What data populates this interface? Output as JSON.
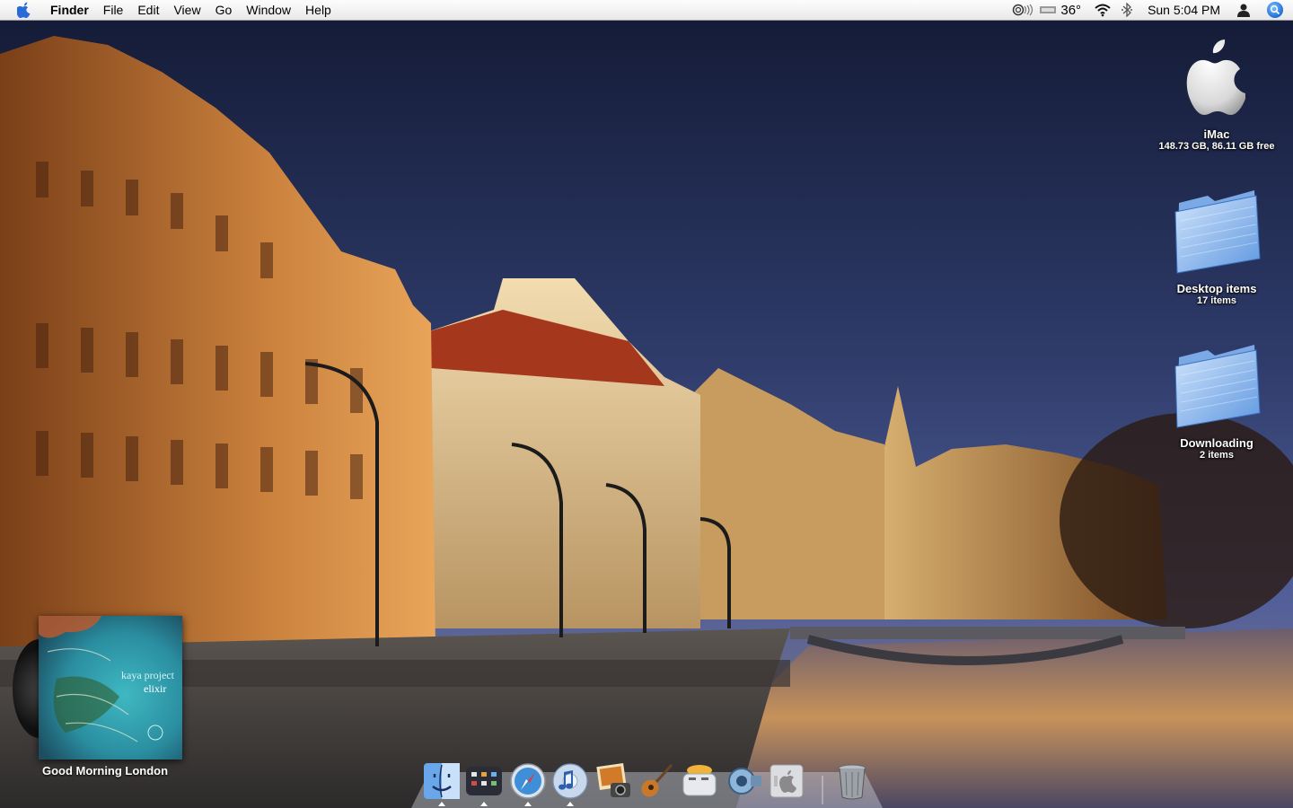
{
  "menubar": {
    "app_name": "Finder",
    "menus": [
      "File",
      "Edit",
      "View",
      "Go",
      "Window",
      "Help"
    ],
    "temperature": "36°",
    "clock": "Sun 5:04 PM",
    "icons": [
      "apple-icon",
      "airtunes-icon",
      "weather-icon",
      "wifi-icon",
      "bluetooth-icon",
      "user-icon",
      "spotlight-icon"
    ]
  },
  "desktop": {
    "items": [
      {
        "name": "iMac",
        "detail": "148.73 GB, 86.11 GB free",
        "icon": "hard-drive-icon"
      },
      {
        "name": "Desktop items",
        "detail": "17 items",
        "icon": "folder-icon"
      },
      {
        "name": "Downloading",
        "detail": "2 items",
        "icon": "folder-icon"
      }
    ]
  },
  "now_playing": {
    "album_text_line1": "kaya project",
    "album_text_line2": "elixir",
    "track": "Good Morning London"
  },
  "dock": {
    "items": [
      "finder-icon",
      "dashboard-icon",
      "safari-icon",
      "itunes-icon",
      "iphoto-icon",
      "garageband-icon",
      "toaster-icon",
      "utility-icon",
      "system-icon",
      "trash-icon"
    ],
    "running": [
      "finder-icon",
      "dashboard-icon",
      "safari-icon",
      "itunes-icon"
    ]
  },
  "colors": {
    "menubar": "#f2f2f2",
    "sky_top": "#141a33",
    "sky_mid": "#3b4a7a",
    "building_light": "#e9b46a",
    "building_dark": "#6a3a1a",
    "river": "#4a4660",
    "folder_blue": "#7fb2ec"
  }
}
